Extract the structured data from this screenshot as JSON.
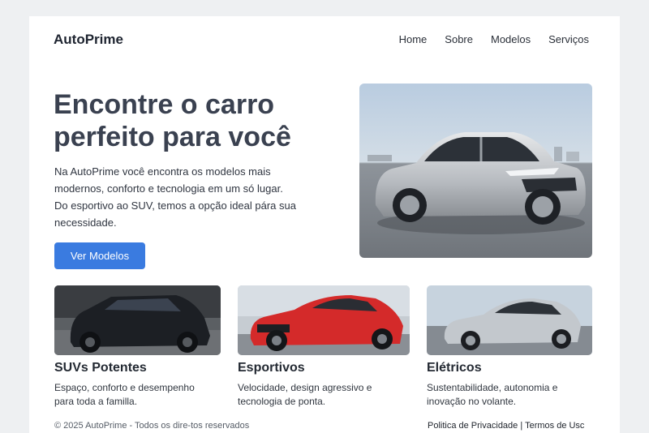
{
  "header": {
    "brand": "AutoPrime",
    "nav": [
      "Home",
      "Sobre",
      "Modelos",
      "Serviços"
    ]
  },
  "hero": {
    "title": "Encontre o carro perfeito para você",
    "description": "Na AutoPrime você encontra os modelos mais modernos, conforto e tecnologia em um só lugar. Do esportivo ao SUV, temos a opção ideal pára sua necessidade.",
    "cta_label": "Ver Modelos"
  },
  "cards": [
    {
      "title": "SUVs Potentes",
      "desc": "Espaço, conforto e desempenho para toda a familla."
    },
    {
      "title": "Esportivos",
      "desc": "Velocidade, design agressivo e tecnologia de ponta."
    },
    {
      "title": "Elétricos",
      "desc": "Sustentabilidade, autonomia e inovação no volante."
    }
  ],
  "footer": {
    "copyright": "© 2025 AutoPrime - Todos os dire-tos reservados",
    "privacy": "Politica de Privacidade",
    "separator": " | ",
    "terms": "Termos de Usc"
  },
  "colors": {
    "accent": "#3a7be0",
    "heading": "#3a4150",
    "background": "#eef0f2"
  }
}
